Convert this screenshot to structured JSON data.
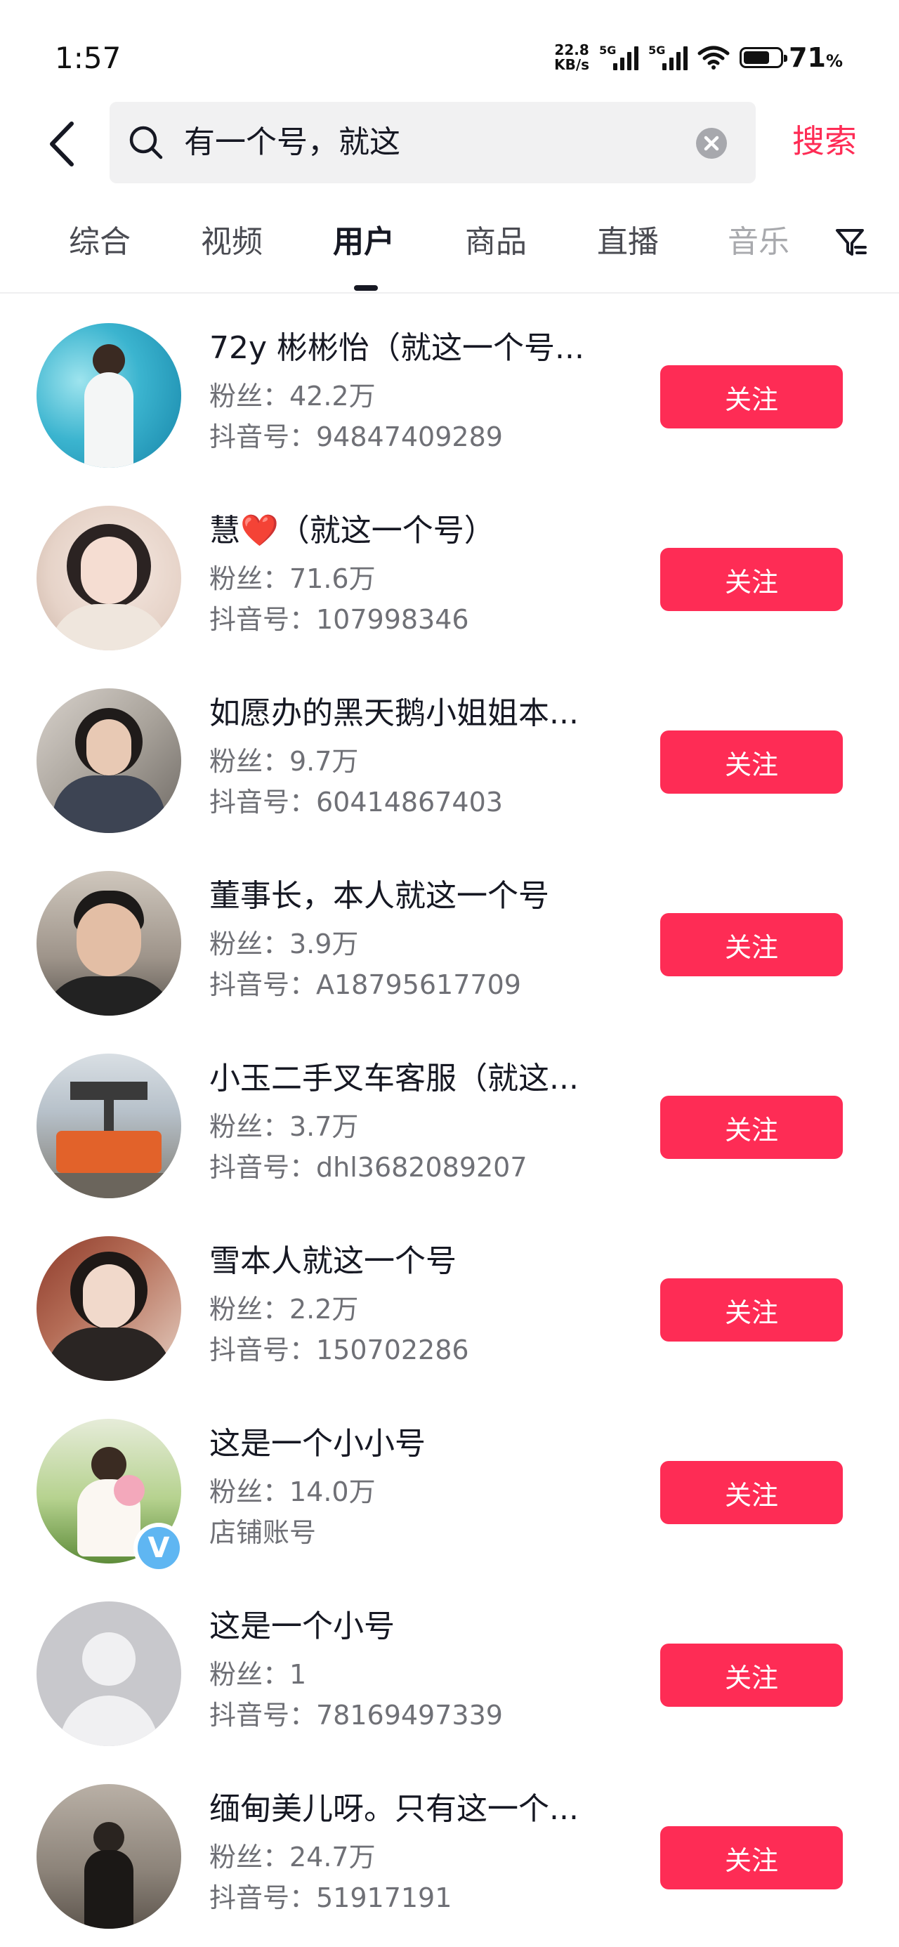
{
  "status_bar": {
    "time": "1:57",
    "net_speed_value": "22.8",
    "net_speed_unit": "KB/s",
    "sim1_label": "5G",
    "sim2_label": "5G",
    "battery_percent": "71",
    "battery_percent_sign": "%",
    "battery_level": 0.71
  },
  "search": {
    "query": "有一个号，就这",
    "submit_label": "搜索"
  },
  "tabs": [
    {
      "label": "综合",
      "active": false
    },
    {
      "label": "视频",
      "active": false
    },
    {
      "label": "用户",
      "active": true
    },
    {
      "label": "商品",
      "active": false
    },
    {
      "label": "直播",
      "active": false
    },
    {
      "label": "音乐",
      "active": false
    }
  ],
  "users": [
    {
      "name": "72y 彬彬怡（就这一个号...",
      "fans": "粉丝：42.2万",
      "id": "抖音号：94847409289",
      "verified": false,
      "follow_label": "关注"
    },
    {
      "name": "慧❤️（就这一个号）",
      "fans": "粉丝：71.6万",
      "id": "抖音号：107998346",
      "verified": false,
      "follow_label": "关注"
    },
    {
      "name": "如愿办的黑天鹅小姐姐本...",
      "fans": "粉丝：9.7万",
      "id": "抖音号：60414867403",
      "verified": false,
      "follow_label": "关注"
    },
    {
      "name": "董事长，本人就这一个号",
      "fans": "粉丝：3.9万",
      "id": "抖音号：A18795617709",
      "verified": false,
      "follow_label": "关注"
    },
    {
      "name": "小玉二手叉车客服（就这...",
      "fans": "粉丝：3.7万",
      "id": "抖音号：dhl3682089207",
      "verified": false,
      "follow_label": "关注"
    },
    {
      "name": "雪本人就这一个号",
      "fans": "粉丝：2.2万",
      "id": "抖音号：150702286",
      "verified": false,
      "follow_label": "关注"
    },
    {
      "name": "这是一个小小号",
      "fans": "粉丝：14.0万",
      "id": "店铺账号",
      "verified": true,
      "badge_letter": "V",
      "follow_label": "关注"
    },
    {
      "name": "这是一个小号",
      "fans": "粉丝：1",
      "id": "抖音号：78169497339",
      "verified": false,
      "follow_label": "关注"
    },
    {
      "name": "缅甸美儿呀。只有这一个...",
      "fans": "粉丝：24.7万",
      "id": "抖音号：51917191",
      "verified": false,
      "follow_label": "关注"
    }
  ],
  "colors": {
    "accent": "#fe2c55",
    "text_primary": "#161823",
    "text_secondary": "#6f7076",
    "search_bg": "#f1f1f2"
  }
}
